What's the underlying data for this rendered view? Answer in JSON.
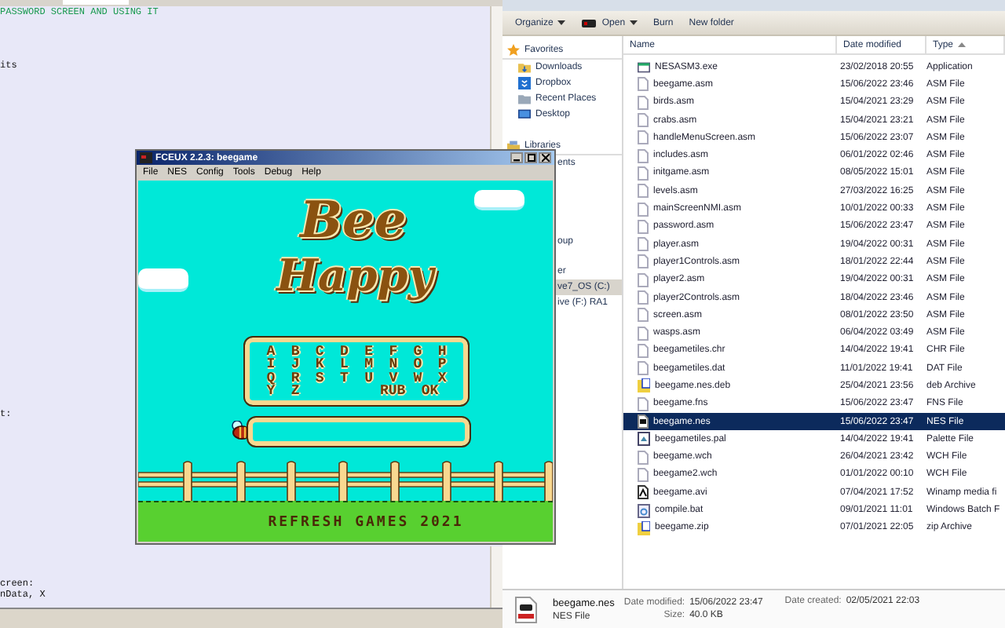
{
  "editor": {
    "lines": [
      {
        "text": "PASSWORD SCREEN AND USING IT",
        "kind": "comment"
      },
      {
        "text": "its",
        "kind": "code"
      },
      {
        "text": "t:",
        "kind": "code"
      },
      {
        "text": "creen:",
        "kind": "code"
      },
      {
        "text": "nData, X",
        "kind": "code"
      }
    ]
  },
  "emulator": {
    "title": "FCEUX 2.2.3: beegame",
    "menu": [
      "File",
      "NES",
      "Config",
      "Tools",
      "Debug",
      "Help"
    ],
    "game": {
      "logo": [
        "Bee",
        "Happy"
      ],
      "letter_rows": [
        [
          "A",
          "B",
          "C",
          "D",
          "E",
          "F",
          "G",
          "H"
        ],
        [
          "I",
          "J",
          "K",
          "L",
          "M",
          "N",
          "O",
          "P"
        ],
        [
          "Q",
          "R",
          "S",
          "T",
          "U",
          "V",
          "W",
          "X"
        ],
        [
          "Y",
          "Z",
          "RUB",
          "OK"
        ]
      ],
      "footer": "REFRESH GAMES 2021"
    }
  },
  "explorer": {
    "toolbar": [
      {
        "label": "Organize",
        "kind": "plain",
        "dropdown": true
      },
      {
        "label": "Open",
        "kind": "open",
        "dropdown": true
      },
      {
        "label": "Burn",
        "kind": "plain",
        "dropdown": false
      },
      {
        "label": "New folder",
        "kind": "plain",
        "dropdown": false
      }
    ],
    "nav": [
      {
        "label": "Favorites",
        "kind": "header",
        "selected": false
      },
      {
        "label": "Downloads",
        "kind": "item",
        "selected": false
      },
      {
        "label": "Dropbox",
        "kind": "item",
        "selected": false
      },
      {
        "label": "Recent Places",
        "kind": "item",
        "selected": false
      },
      {
        "label": "Desktop",
        "kind": "item",
        "selected": false
      },
      {
        "label": "Libraries",
        "kind": "header",
        "selected": false
      },
      {
        "label": "ents",
        "kind": "partial",
        "selected": false
      },
      {
        "label": "oup",
        "kind": "partial",
        "selected": false
      },
      {
        "label": "er",
        "kind": "partial",
        "selected": false
      },
      {
        "label": "ve7_OS (C:)",
        "kind": "partial",
        "selected": true
      },
      {
        "label": "ive (F:) RA1",
        "kind": "partial",
        "selected": false
      }
    ],
    "columns": [
      {
        "label": "Name",
        "sorted": false
      },
      {
        "label": "Date modified",
        "sorted": false
      },
      {
        "label": "Type",
        "sorted": true
      }
    ],
    "files": [
      {
        "name": "NESASM3.exe",
        "date": "23/02/2018 20:55",
        "type": "Application",
        "kind": "app",
        "selected": false
      },
      {
        "name": "beegame.asm",
        "date": "15/06/2022 23:46",
        "type": "ASM File",
        "kind": "doc",
        "selected": false
      },
      {
        "name": "birds.asm",
        "date": "15/04/2021 23:29",
        "type": "ASM File",
        "kind": "doc",
        "selected": false
      },
      {
        "name": "crabs.asm",
        "date": "15/04/2021 23:21",
        "type": "ASM File",
        "kind": "doc",
        "selected": false
      },
      {
        "name": "handleMenuScreen.asm",
        "date": "15/06/2022 23:07",
        "type": "ASM File",
        "kind": "doc",
        "selected": false
      },
      {
        "name": "includes.asm",
        "date": "06/01/2022 02:46",
        "type": "ASM File",
        "kind": "doc",
        "selected": false
      },
      {
        "name": "initgame.asm",
        "date": "08/05/2022 15:01",
        "type": "ASM File",
        "kind": "doc",
        "selected": false
      },
      {
        "name": "levels.asm",
        "date": "27/03/2022 16:25",
        "type": "ASM File",
        "kind": "doc",
        "selected": false
      },
      {
        "name": "mainScreenNMI.asm",
        "date": "10/01/2022 00:33",
        "type": "ASM File",
        "kind": "doc",
        "selected": false
      },
      {
        "name": "password.asm",
        "date": "15/06/2022 23:47",
        "type": "ASM File",
        "kind": "doc",
        "selected": false
      },
      {
        "name": "player.asm",
        "date": "19/04/2022 00:31",
        "type": "ASM File",
        "kind": "doc",
        "selected": false
      },
      {
        "name": "player1Controls.asm",
        "date": "18/01/2022 22:44",
        "type": "ASM File",
        "kind": "doc",
        "selected": false
      },
      {
        "name": "player2.asm",
        "date": "19/04/2022 00:31",
        "type": "ASM File",
        "kind": "doc",
        "selected": false
      },
      {
        "name": "player2Controls.asm",
        "date": "18/04/2022 23:46",
        "type": "ASM File",
        "kind": "doc",
        "selected": false
      },
      {
        "name": "screen.asm",
        "date": "08/01/2022 23:50",
        "type": "ASM File",
        "kind": "doc",
        "selected": false
      },
      {
        "name": "wasps.asm",
        "date": "06/04/2022 03:49",
        "type": "ASM File",
        "kind": "doc",
        "selected": false
      },
      {
        "name": "beegametiles.chr",
        "date": "14/04/2022 19:41",
        "type": "CHR File",
        "kind": "doc",
        "selected": false
      },
      {
        "name": "beegametiles.dat",
        "date": "11/01/2022 19:41",
        "type": "DAT File",
        "kind": "doc",
        "selected": false
      },
      {
        "name": "beegame.nes.deb",
        "date": "25/04/2021 23:56",
        "type": "deb Archive",
        "kind": "archive",
        "selected": false
      },
      {
        "name": "beegame.fns",
        "date": "15/06/2022 23:47",
        "type": "FNS File",
        "kind": "doc",
        "selected": false
      },
      {
        "name": "beegame.nes",
        "date": "15/06/2022 23:47",
        "type": "NES File",
        "kind": "rom",
        "selected": true
      },
      {
        "name": "beegametiles.pal",
        "date": "14/04/2022 19:41",
        "type": "Palette File",
        "kind": "palette",
        "selected": false
      },
      {
        "name": "beegame.wch",
        "date": "26/04/2021 23:42",
        "type": "WCH File",
        "kind": "doc",
        "selected": false
      },
      {
        "name": "beegame2.wch",
        "date": "01/01/2022 00:10",
        "type": "WCH File",
        "kind": "doc",
        "selected": false
      },
      {
        "name": "beegame.avi",
        "date": "07/04/2021 17:52",
        "type": "Winamp media fi",
        "kind": "media",
        "selected": false
      },
      {
        "name": "compile.bat",
        "date": "09/01/2021 11:01",
        "type": "Windows Batch F",
        "kind": "script",
        "selected": false
      },
      {
        "name": "beegame.zip",
        "date": "07/01/2021 22:05",
        "type": "zip Archive",
        "kind": "archive",
        "selected": false
      }
    ],
    "details": {
      "name": "beegame.nes",
      "type": "NES File",
      "modified_label": "Date modified:",
      "modified": "15/06/2022 23:47",
      "created_label": "Date created:",
      "created": "02/05/2021 22:03",
      "size_label": "Size:",
      "size": "40.0 KB"
    }
  }
}
